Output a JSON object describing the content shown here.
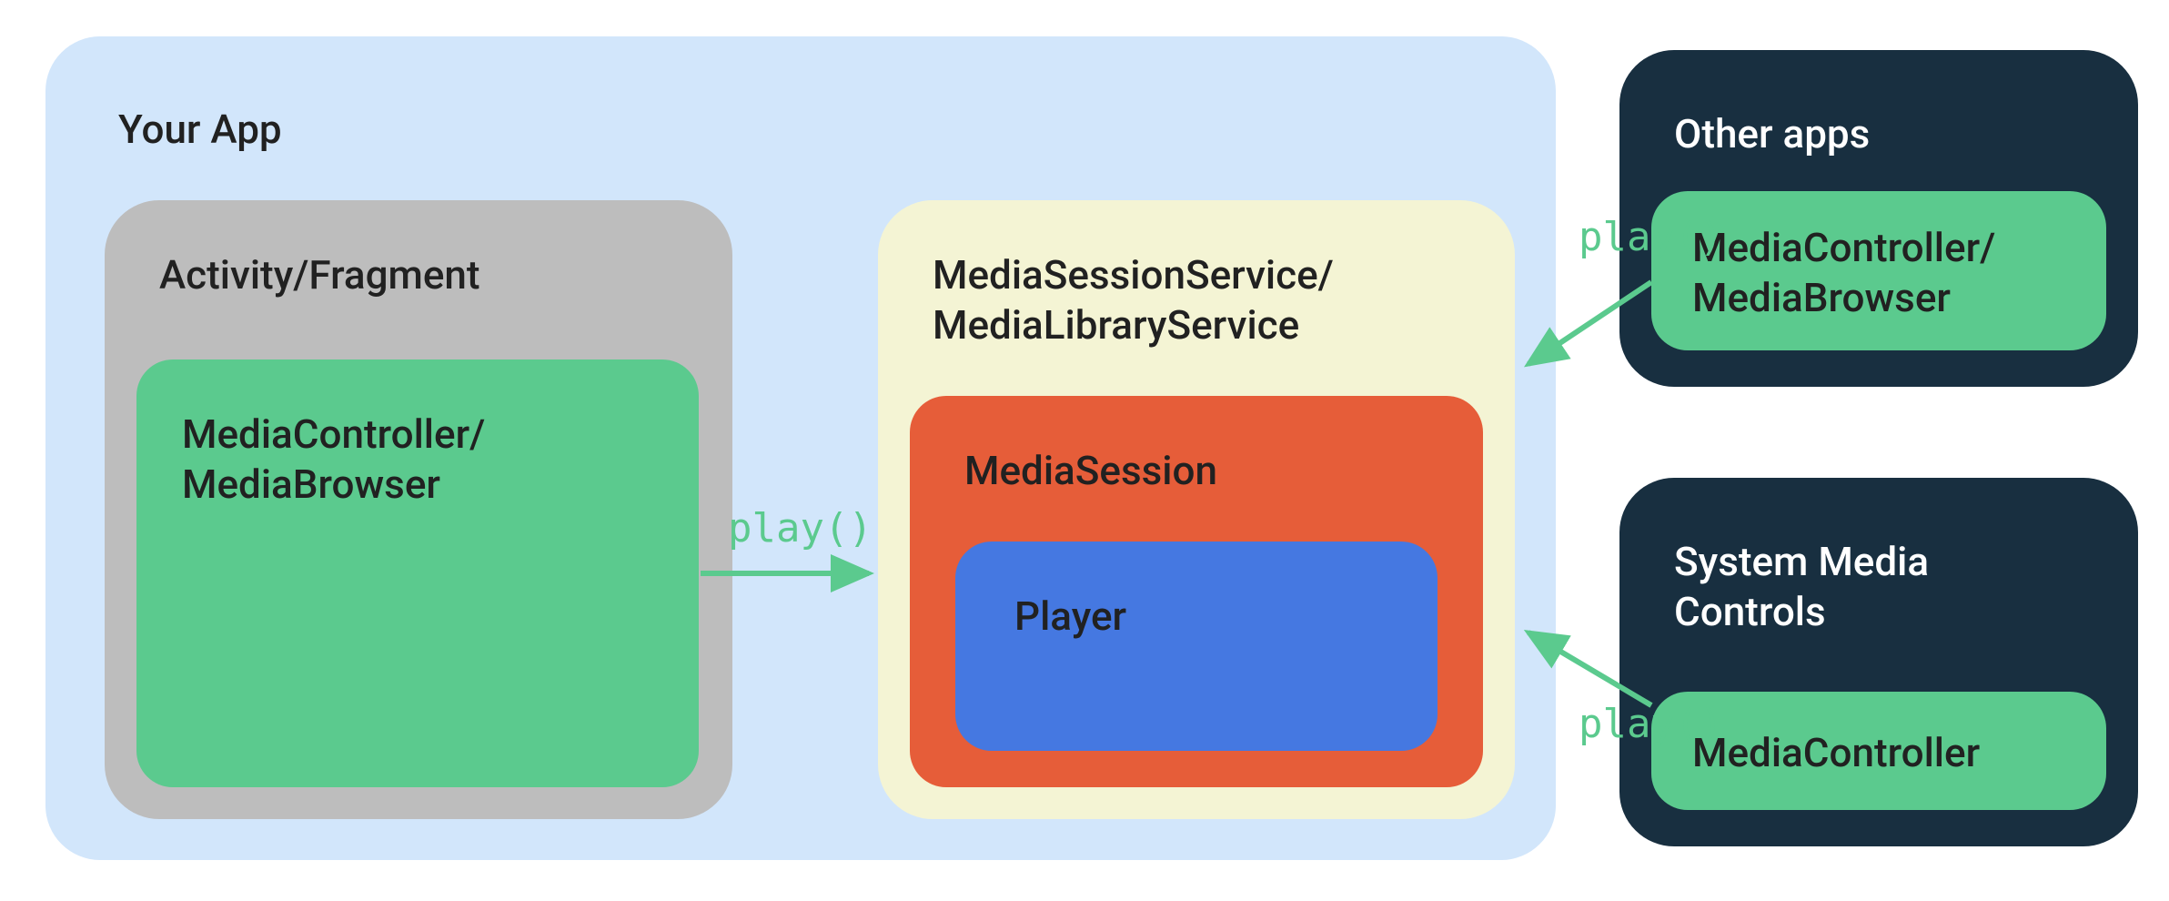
{
  "your_app": {
    "title": "Your App",
    "activity": {
      "title": "Activity/Fragment",
      "controller": "MediaController/\nMediaBrowser"
    },
    "service": {
      "title": "MediaSessionService/\nMediaLibraryService",
      "session": "MediaSession",
      "player": "Player"
    }
  },
  "other_apps": {
    "title": "Other apps",
    "controller": "MediaController/\nMediaBrowser"
  },
  "system_controls": {
    "title": "System Media\nControls",
    "controller": "MediaController"
  },
  "call_labels": {
    "play1": "play()",
    "play2": "play()",
    "play3": "play()"
  }
}
